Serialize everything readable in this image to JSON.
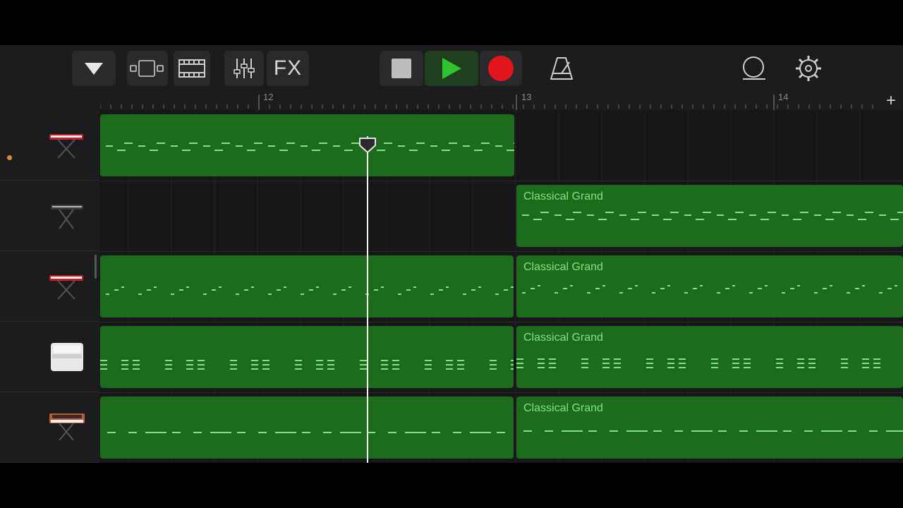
{
  "toolbar": {
    "fx_label": "FX",
    "buttons": [
      {
        "name": "browser-toggle",
        "icon": "triangle-down-icon"
      },
      {
        "name": "view-toggle",
        "icon": "tracks-view-icon"
      },
      {
        "name": "live-loops",
        "icon": "film-strip-icon"
      },
      {
        "name": "mixer",
        "icon": "sliders-icon"
      },
      {
        "name": "fx",
        "icon": "fx-icon"
      },
      {
        "name": "stop",
        "icon": "stop-icon"
      },
      {
        "name": "play",
        "icon": "play-icon"
      },
      {
        "name": "record",
        "icon": "record-icon"
      },
      {
        "name": "metronome",
        "icon": "metronome-icon"
      },
      {
        "name": "loop-browser",
        "icon": "loop-icon"
      },
      {
        "name": "settings",
        "icon": "gear-icon"
      }
    ]
  },
  "ruler": {
    "bars": [
      "12",
      "13",
      "14"
    ],
    "add_label": "+"
  },
  "tracks": [
    {
      "instrument": "red-keyboard-icon",
      "regions": [
        {
          "label": ""
        }
      ]
    },
    {
      "instrument": "black-keyboard-icon",
      "regions": [
        {
          "label": "Classical Grand"
        }
      ]
    },
    {
      "instrument": "red-keyboard-icon",
      "regions": [
        {
          "label": ""
        },
        {
          "label": "Classical Grand"
        }
      ]
    },
    {
      "instrument": "upright-piano-icon",
      "regions": [
        {
          "label": ""
        },
        {
          "label": "Classical Grand"
        }
      ]
    },
    {
      "instrument": "synth-icon",
      "regions": [
        {
          "label": ""
        },
        {
          "label": "Classical Grand"
        }
      ]
    }
  ],
  "colors": {
    "region": "#1d6b1d",
    "note": "#7fe57f",
    "play": "#2ec52e",
    "record": "#e3161c",
    "background": "#1c1c1e"
  }
}
